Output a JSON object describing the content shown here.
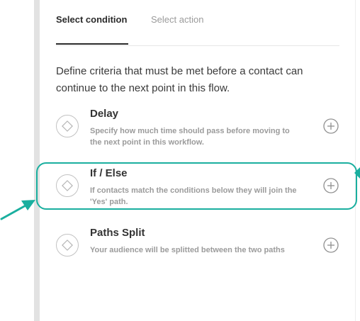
{
  "tabs": {
    "condition_label": "Select condition",
    "action_label": "Select action",
    "active": "condition"
  },
  "description": "Define criteria that must be met before a contact can continue to the next point in this flow.",
  "options": [
    {
      "title": "Delay",
      "subtitle": "Specify how much time should pass before moving to the next point in this workflow.",
      "icon": "diamond-icon",
      "action_icon": "add-circle-icon"
    },
    {
      "title": "If / Else",
      "subtitle": "If contacts match the conditions below they will join the 'Yes' path.",
      "icon": "diamond-icon",
      "action_icon": "add-circle-icon",
      "highlighted": true
    },
    {
      "title": "Paths Split",
      "subtitle": "Your audience will be splitted between the two paths",
      "icon": "diamond-icon",
      "action_icon": "add-circle-icon"
    }
  ],
  "colors": {
    "highlight": "#1aaf9f",
    "text_primary": "#2b2b2b",
    "text_muted": "#9b9b9b"
  }
}
